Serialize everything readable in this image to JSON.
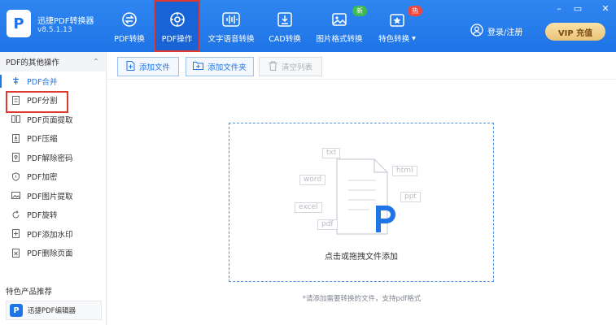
{
  "app": {
    "name": "迅捷PDF转换器",
    "version": "v8.5.1.13",
    "logo_letter": "P"
  },
  "nav": [
    {
      "label": "PDF转换",
      "icon": "convert-icon"
    },
    {
      "label": "PDF操作",
      "icon": "pdf-operation-icon",
      "active": true
    },
    {
      "label": "文字语音转换",
      "icon": "audio-wave-icon"
    },
    {
      "label": "CAD转换",
      "icon": "cad-icon"
    },
    {
      "label": "图片格式转换",
      "icon": "image-icon",
      "badge": "新"
    },
    {
      "label": "特色转换",
      "icon": "special-convert-icon",
      "badge": "热",
      "dropdown": "▾"
    }
  ],
  "badge_colors": {
    "new": "#3dbb4c",
    "hot": "#f0483e"
  },
  "login": {
    "label": "登录/注册",
    "icon": "user-icon"
  },
  "vip": {
    "label": "VIP 充值"
  },
  "window_controls": {
    "minimize": "–",
    "restore": "▭",
    "close": "✕"
  },
  "sidebar": {
    "section_title": "PDF的其他操作",
    "collapse_symbol": "⌃",
    "items": [
      {
        "label": "PDF合并",
        "icon": "merge-icon"
      },
      {
        "label": "PDF分割",
        "icon": "split-icon"
      },
      {
        "label": "PDF页面提取",
        "icon": "page-extract-icon"
      },
      {
        "label": "PDF压缩",
        "icon": "compress-icon"
      },
      {
        "label": "PDF解除密码",
        "icon": "unlock-icon"
      },
      {
        "label": "PDF加密",
        "icon": "shield-icon"
      },
      {
        "label": "PDF图片提取",
        "icon": "image-extract-icon"
      },
      {
        "label": "PDF旋转",
        "icon": "rotate-icon"
      },
      {
        "label": "PDF添加水印",
        "icon": "watermark-icon"
      },
      {
        "label": "PDF删除页面",
        "icon": "delete-page-icon"
      }
    ],
    "footer_title": "特色产品推荐",
    "product": {
      "label": "迅捷PDF编辑器",
      "icon_letter": "P"
    }
  },
  "toolbar": {
    "add_file": "添加文件",
    "add_folder": "添加文件夹",
    "clear_list": "清空列表"
  },
  "dropzone": {
    "text": "点击或拖拽文件添加",
    "tags": [
      "txt",
      "word",
      "ppt",
      "excel",
      "html",
      "pdf"
    ]
  },
  "hint": "*请添加需要转换的文件，支持pdf格式",
  "colors": {
    "primary": "#1f74e6",
    "highlight": "#e03a2f"
  }
}
